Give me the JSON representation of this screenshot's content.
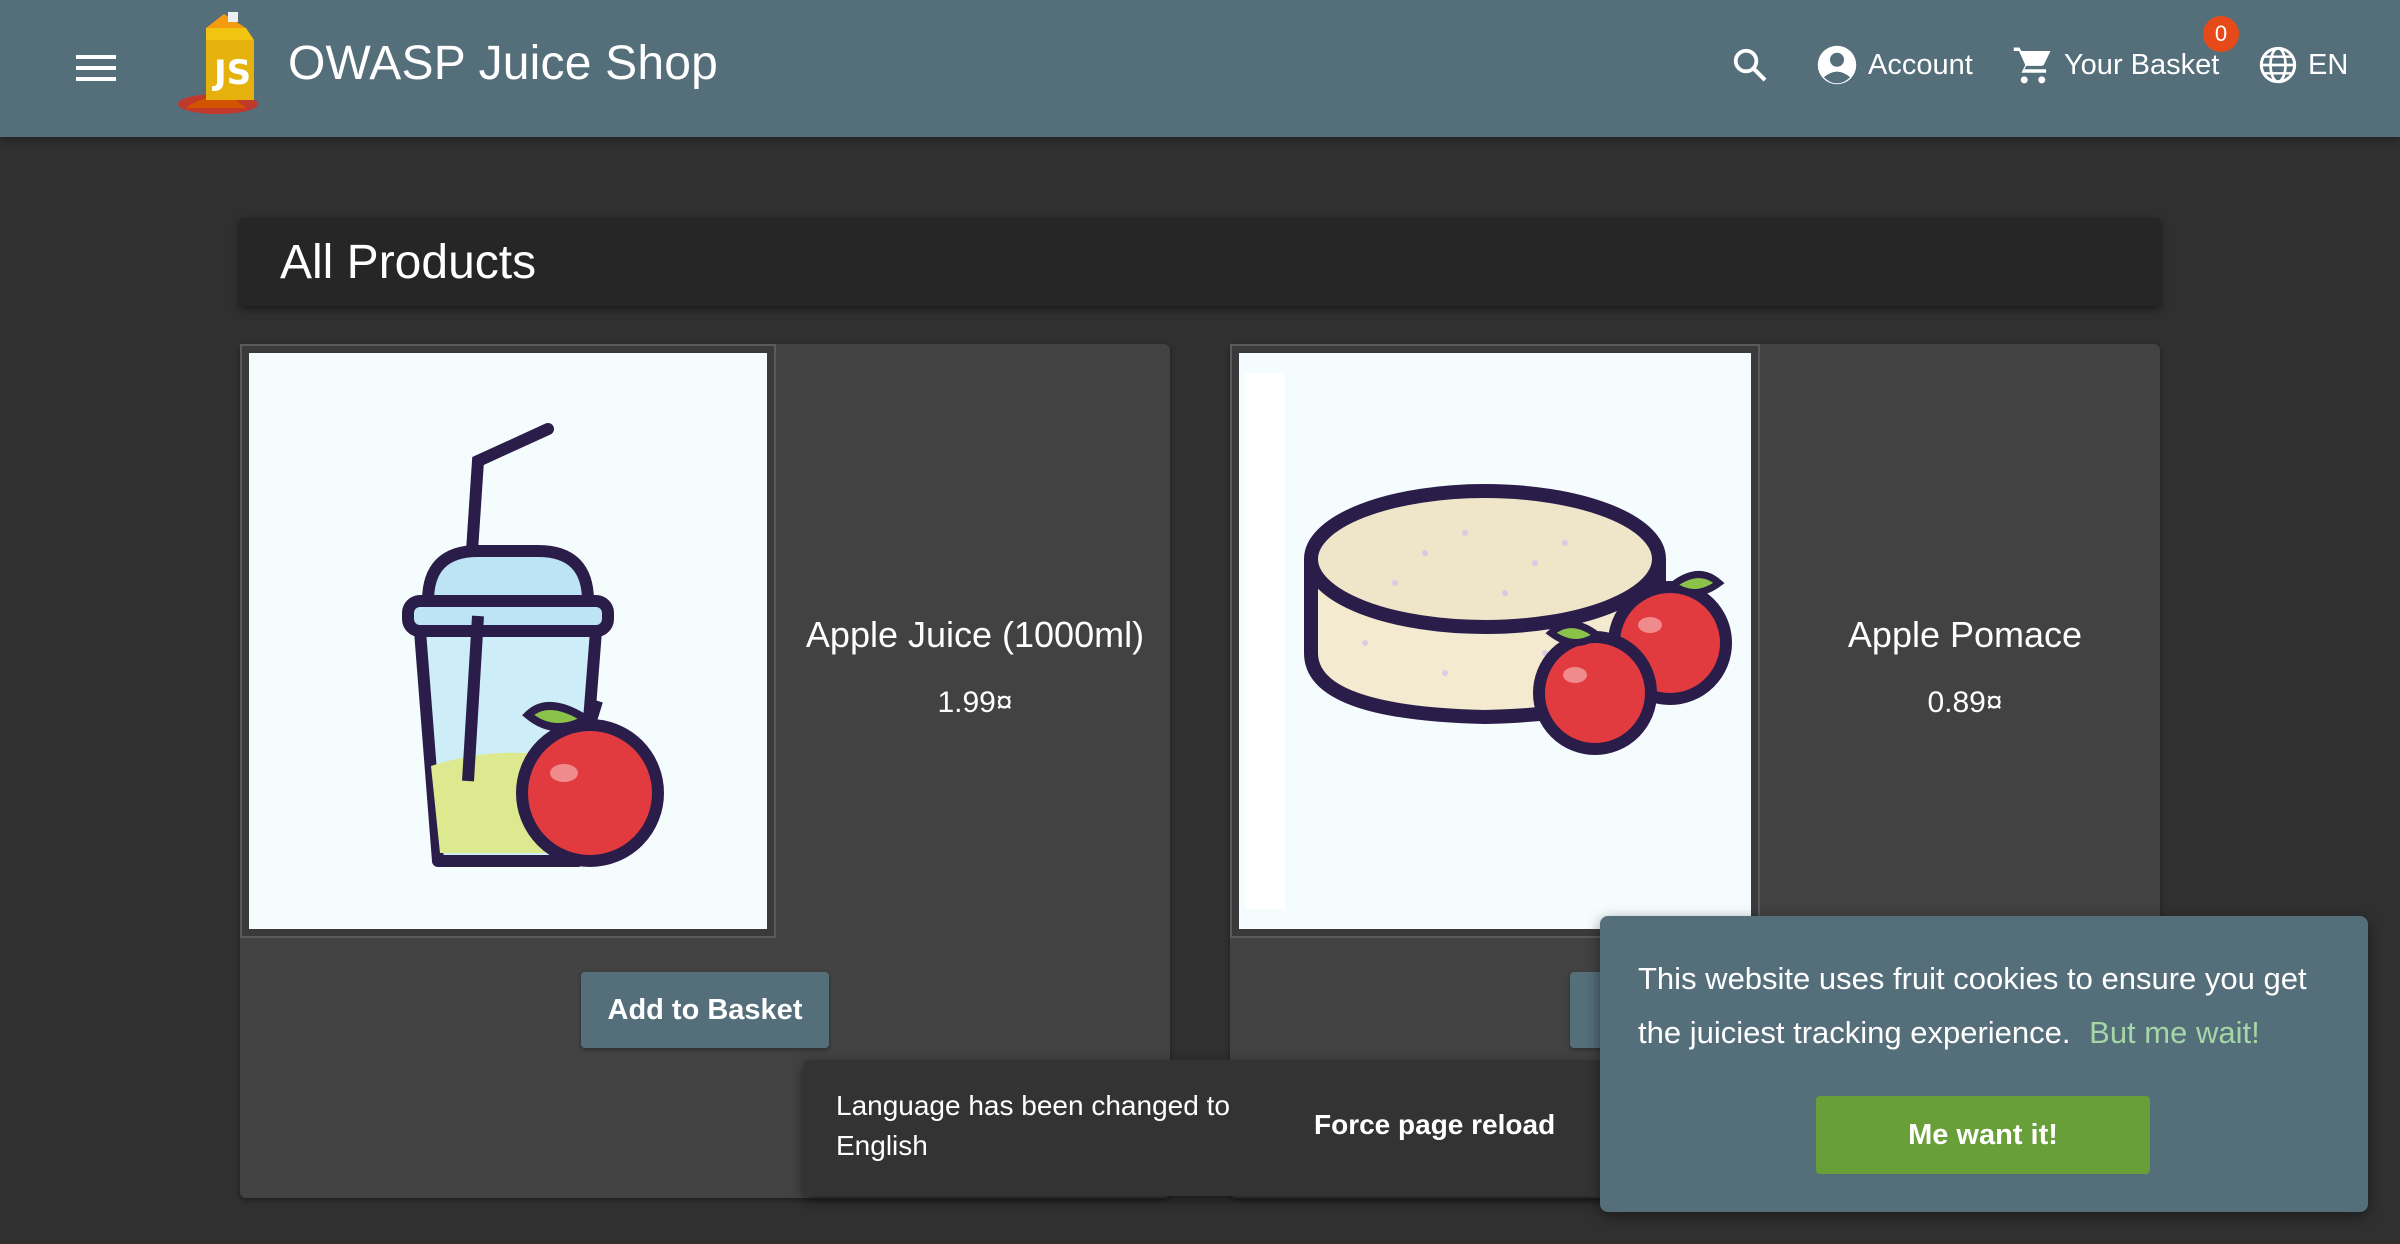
{
  "header": {
    "app_title": "OWASP Juice Shop",
    "menu_icon": "menu-icon",
    "search_icon": "search-icon",
    "account_label": "Account",
    "basket_label": "Your Basket",
    "basket_count": "0",
    "language_label": "EN"
  },
  "main": {
    "heading": "All Products",
    "products": [
      {
        "name": "Apple Juice (1000ml)",
        "price": "1.99¤",
        "button": "Add to Basket"
      },
      {
        "name": "Apple Pomace",
        "price": "0.89¤",
        "button": ""
      }
    ]
  },
  "snackbar": {
    "message": "Language has been changed to English",
    "action": "Force page reload"
  },
  "cookie_banner": {
    "message": "This website uses fruit cookies to ensure you get the juiciest tracking experience.",
    "link": "But me wait!",
    "button": "Me want it!"
  },
  "colors": {
    "toolbar": "#546e7a",
    "background": "#303030",
    "card": "#424242",
    "accept_button": "#689f38",
    "badge": "#e64a19",
    "link": "#a5d6a7"
  }
}
